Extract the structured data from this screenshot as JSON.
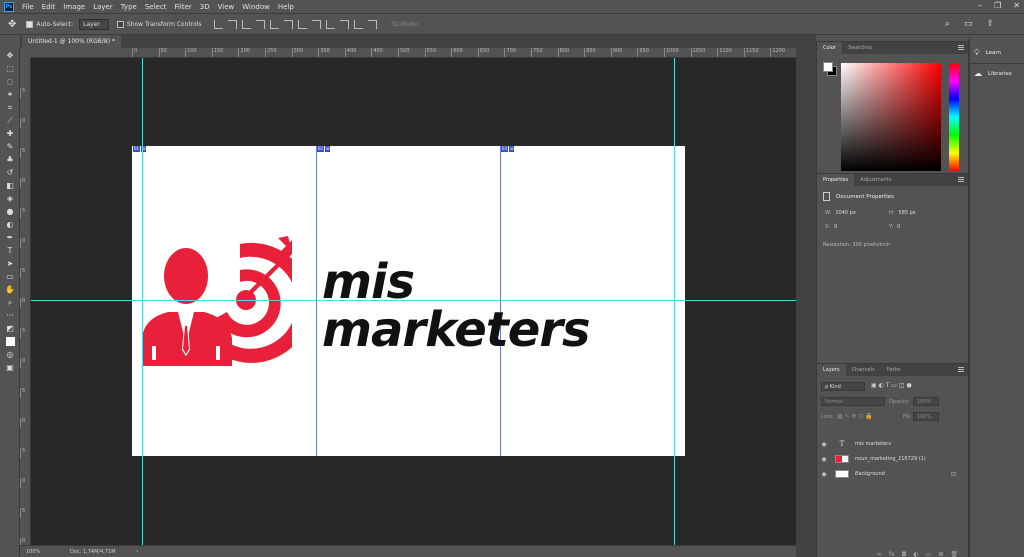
{
  "app": {
    "logo": "Ps"
  },
  "menu": [
    "File",
    "Edit",
    "Image",
    "Layer",
    "Type",
    "Select",
    "Filter",
    "3D",
    "View",
    "Window",
    "Help"
  ],
  "options": {
    "auto_select_label": "Auto-Select:",
    "auto_select_value": "Layer",
    "transform_label": "Show Transform Controls",
    "mode_3d_label": "3D Mode:"
  },
  "document": {
    "tab_title": "Untitled-1 @ 100% (RGB/8) *",
    "zoom": "100%",
    "doc_size": "Doc: 1,74M/4,71M"
  },
  "ruler_h": [
    "0",
    "50",
    "100",
    "150",
    "200",
    "250",
    "300",
    "350",
    "400",
    "450",
    "500",
    "550",
    "600",
    "650",
    "700",
    "750",
    "800",
    "850",
    "900",
    "950",
    "1000",
    "1050",
    "1100",
    "1150",
    "1200"
  ],
  "ruler_v": [
    "5",
    "0",
    "5",
    "0",
    "5",
    "0",
    "5",
    "0",
    "5",
    "0",
    "5",
    "0",
    "5",
    "0",
    "5",
    "0"
  ],
  "slices": [
    {
      "id": "01",
      "icon": "⊞"
    },
    {
      "id": "02",
      "icon": "⊞"
    },
    {
      "id": "03",
      "icon": "⊞"
    }
  ],
  "logo": {
    "line1": "mis",
    "line2": "marketers",
    "accent_color": "#e8203a"
  },
  "color_panel": {
    "tabs": [
      "Color",
      "Swatches"
    ]
  },
  "properties_panel": {
    "tabs": [
      "Properties",
      "Adjustments"
    ],
    "title": "Document Properties",
    "w_label": "W:",
    "w_value": "1040 px",
    "h_label": "H:",
    "h_value": "585 px",
    "x_label": "X:",
    "x_value": "0",
    "y_label": "Y:",
    "y_value": "0",
    "resolution": "Resolution: 300 pixels/inch"
  },
  "layers_panel": {
    "tabs": [
      "Layers",
      "Channels",
      "Paths"
    ],
    "kind_label": "ρ Kind",
    "blend_mode": "Normal",
    "opacity_label": "Opacity:",
    "opacity_value": "100%",
    "lock_label": "Lock:",
    "fill_label": "Fill:",
    "fill_value": "100%",
    "layers": [
      {
        "name": "mis marketers",
        "type": "text"
      },
      {
        "name": "noun_marketing_216729 (1)",
        "type": "smart"
      },
      {
        "name": "Background",
        "type": "background"
      }
    ]
  },
  "dock": {
    "learn": "Learn",
    "libraries": "Libraries"
  }
}
